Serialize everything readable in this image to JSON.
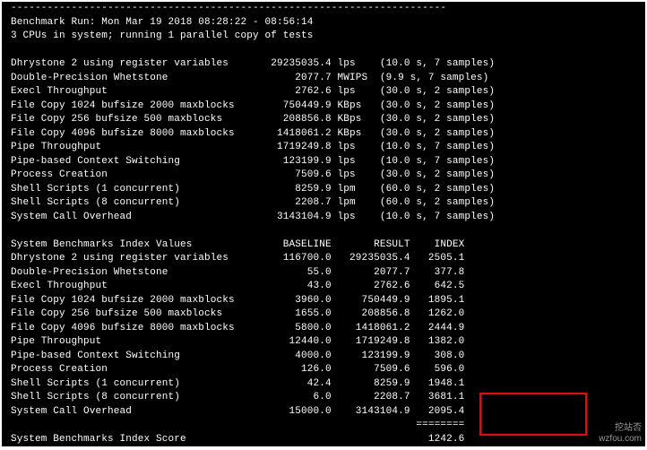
{
  "header": {
    "sep": "------------------------------------------------------------------------",
    "run_line": "Benchmark Run: Mon Mar 19 2018 08:28:22 - 08:56:14",
    "cpu_line": "3 CPUs in system; running 1 parallel copy of tests"
  },
  "results": [
    {
      "name": "Dhrystone 2 using register variables",
      "value": "29235035.4",
      "unit": "lps",
      "timing": "(10.0 s, 7 samples)"
    },
    {
      "name": "Double-Precision Whetstone",
      "value": "2077.7",
      "unit": "MWIPS",
      "timing": "(9.9 s, 7 samples)"
    },
    {
      "name": "Execl Throughput",
      "value": "2762.6",
      "unit": "lps",
      "timing": "(30.0 s, 2 samples)"
    },
    {
      "name": "File Copy 1024 bufsize 2000 maxblocks",
      "value": "750449.9",
      "unit": "KBps",
      "timing": "(30.0 s, 2 samples)"
    },
    {
      "name": "File Copy 256 bufsize 500 maxblocks",
      "value": "208856.8",
      "unit": "KBps",
      "timing": "(30.0 s, 2 samples)"
    },
    {
      "name": "File Copy 4096 bufsize 8000 maxblocks",
      "value": "1418061.2",
      "unit": "KBps",
      "timing": "(30.0 s, 2 samples)"
    },
    {
      "name": "Pipe Throughput",
      "value": "1719249.8",
      "unit": "lps",
      "timing": "(10.0 s, 7 samples)"
    },
    {
      "name": "Pipe-based Context Switching",
      "value": "123199.9",
      "unit": "lps",
      "timing": "(10.0 s, 7 samples)"
    },
    {
      "name": "Process Creation",
      "value": "7509.6",
      "unit": "lps",
      "timing": "(30.0 s, 2 samples)"
    },
    {
      "name": "Shell Scripts (1 concurrent)",
      "value": "8259.9",
      "unit": "lpm",
      "timing": "(60.0 s, 2 samples)"
    },
    {
      "name": "Shell Scripts (8 concurrent)",
      "value": "2208.7",
      "unit": "lpm",
      "timing": "(60.0 s, 2 samples)"
    },
    {
      "name": "System Call Overhead",
      "value": "3143104.9",
      "unit": "lps",
      "timing": "(10.0 s, 7 samples)"
    }
  ],
  "index_header": {
    "title": "System Benchmarks Index Values",
    "baseline": "BASELINE",
    "result": "RESULT",
    "index": "INDEX"
  },
  "index_rows": [
    {
      "name": "Dhrystone 2 using register variables",
      "baseline": "116700.0",
      "result": "29235035.4",
      "index": "2505.1"
    },
    {
      "name": "Double-Precision Whetstone",
      "baseline": "55.0",
      "result": "2077.7",
      "index": "377.8"
    },
    {
      "name": "Execl Throughput",
      "baseline": "43.0",
      "result": "2762.6",
      "index": "642.5"
    },
    {
      "name": "File Copy 1024 bufsize 2000 maxblocks",
      "baseline": "3960.0",
      "result": "750449.9",
      "index": "1895.1"
    },
    {
      "name": "File Copy 256 bufsize 500 maxblocks",
      "baseline": "1655.0",
      "result": "208856.8",
      "index": "1262.0"
    },
    {
      "name": "File Copy 4096 bufsize 8000 maxblocks",
      "baseline": "5800.0",
      "result": "1418061.2",
      "index": "2444.9"
    },
    {
      "name": "Pipe Throughput",
      "baseline": "12440.0",
      "result": "1719249.8",
      "index": "1382.0"
    },
    {
      "name": "Pipe-based Context Switching",
      "baseline": "4000.0",
      "result": "123199.9",
      "index": "308.0"
    },
    {
      "name": "Process Creation",
      "baseline": "126.0",
      "result": "7509.6",
      "index": "596.0"
    },
    {
      "name": "Shell Scripts (1 concurrent)",
      "baseline": "42.4",
      "result": "8259.9",
      "index": "1948.1"
    },
    {
      "name": "Shell Scripts (8 concurrent)",
      "baseline": "6.0",
      "result": "2208.7",
      "index": "3681.1"
    },
    {
      "name": "System Call Overhead",
      "baseline": "15000.0",
      "result": "3143104.9",
      "index": "2095.4"
    }
  ],
  "score": {
    "rule": "                                                                   ========",
    "label": "System Benchmarks Index Score",
    "value": "1242.6"
  },
  "watermark": {
    "line1": "挖站否",
    "line2": "wzfou.com"
  }
}
